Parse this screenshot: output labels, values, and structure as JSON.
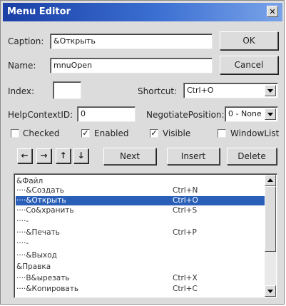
{
  "window": {
    "title": "Menu Editor",
    "close_glyph": "✕"
  },
  "caption": {
    "label": "Caption:",
    "value": "&Открыть"
  },
  "name": {
    "label": "Name:",
    "value": "mnuOpen"
  },
  "index": {
    "label": "Index:",
    "value": ""
  },
  "shortcut": {
    "label": "Shortcut:",
    "value": "Ctrl+O"
  },
  "helpcontext": {
    "label": "HelpContextID:",
    "value": "0"
  },
  "negotiate": {
    "label": "NegotiatePosition:",
    "value": "0 - None"
  },
  "checks": {
    "checked": {
      "label": "Checked",
      "state": false
    },
    "enabled": {
      "label": "Enabled",
      "state": true
    },
    "visible": {
      "label": "Visible",
      "state": true
    },
    "windowlist": {
      "label": "WindowList",
      "state": false
    }
  },
  "buttons": {
    "ok": "OK",
    "cancel": "Cancel",
    "next": "Next",
    "insert": "Insert",
    "delete": "Delete"
  },
  "arrows": {
    "left": "←",
    "right": "→",
    "up": "↑",
    "down": "↓"
  },
  "menu_items": [
    {
      "caption": "&Файл",
      "shortcut": ""
    },
    {
      "caption": "····&Создать",
      "shortcut": "Ctrl+N"
    },
    {
      "caption": "····&Открыть",
      "shortcut": "Ctrl+O",
      "selected": true
    },
    {
      "caption": "····Со&хранить",
      "shortcut": "Ctrl+S"
    },
    {
      "caption": "····-",
      "shortcut": ""
    },
    {
      "caption": "····&Печать",
      "shortcut": "Ctrl+P"
    },
    {
      "caption": "····-",
      "shortcut": ""
    },
    {
      "caption": "····&Выход",
      "shortcut": ""
    },
    {
      "caption": "&Правка",
      "shortcut": ""
    },
    {
      "caption": "····В&ырезать",
      "shortcut": "Ctrl+X"
    },
    {
      "caption": "····&Копировать",
      "shortcut": "Ctrl+C"
    }
  ]
}
